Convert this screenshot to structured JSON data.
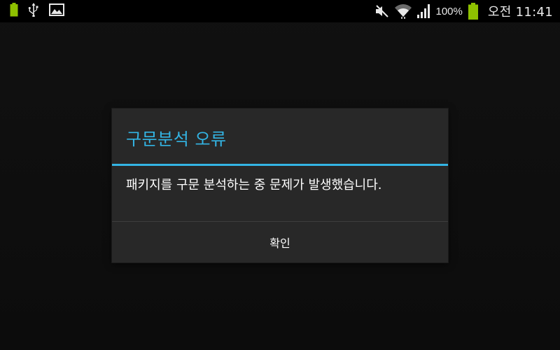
{
  "status_bar": {
    "left_icons": [
      "battery-full-icon",
      "usb-icon",
      "image-icon"
    ],
    "right_icons": [
      "mute-icon",
      "wifi-icon",
      "signal-icon",
      "battery-icon"
    ],
    "battery_percent": "100%",
    "time": "오전 11:41",
    "colors": {
      "battery": "#8ec100",
      "icons": "#e8e8e8"
    }
  },
  "dialog": {
    "title": "구문분석 오류",
    "message": "패키지를 구문 분석하는 중 문제가 발생했습니다.",
    "button_label": "확인",
    "colors": {
      "accent": "#33b5e5",
      "background": "#282828",
      "text": "#ffffff"
    }
  }
}
